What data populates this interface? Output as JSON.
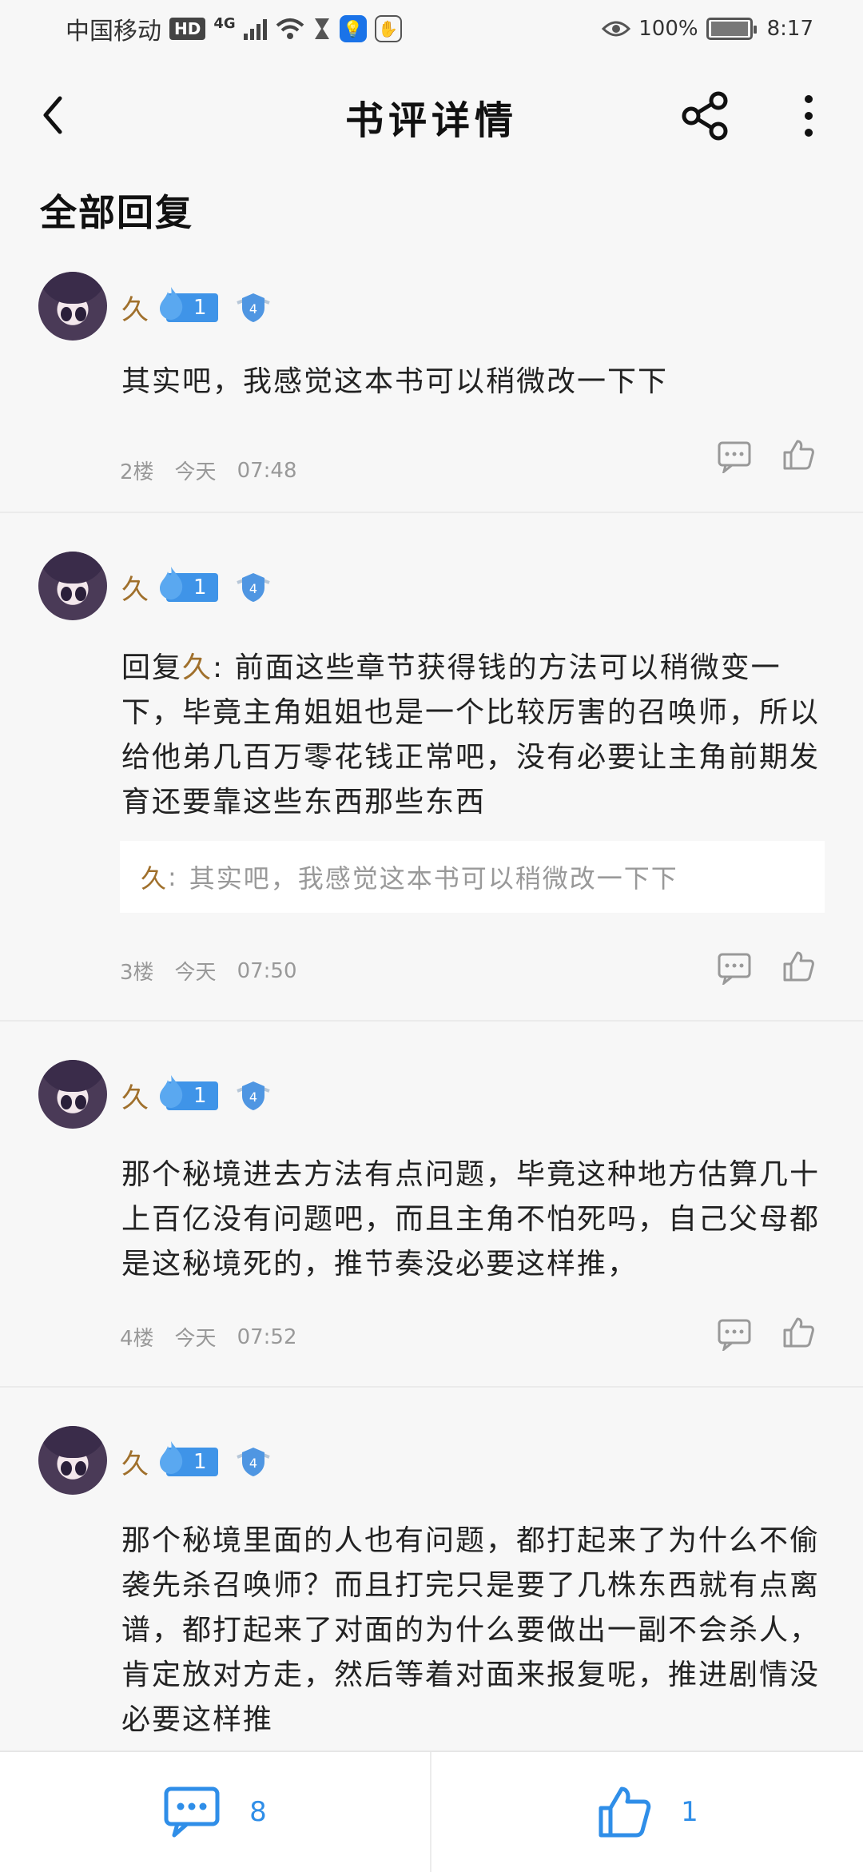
{
  "status_bar": {
    "carrier": "中国移动",
    "hd": "HD",
    "network": "4G",
    "battery": "100%",
    "time": "8:17"
  },
  "header": {
    "title": "书评详情"
  },
  "section": {
    "title": "全部回复"
  },
  "comments": [
    {
      "username": "久",
      "level": "1",
      "shield": "4",
      "text": "其实吧，我感觉这本书可以稍微改一下下",
      "floor": "2楼",
      "date": "今天",
      "time": "07:48"
    },
    {
      "username": "久",
      "level": "1",
      "shield": "4",
      "reply_prefix": "回复",
      "reply_to": "久",
      "reply_colon": ":",
      "text": "前面这些章节获得钱的方法可以稍微变一下，毕竟主角姐姐也是一个比较厉害的召唤师，所以给他弟几百万零花钱正常吧，没有必要让主角前期发育还要靠这些东西那些东西",
      "quote_name": "久",
      "quote_colon": ":",
      "quote_text": "其实吧，我感觉这本书可以稍微改一下下",
      "floor": "3楼",
      "date": "今天",
      "time": "07:50"
    },
    {
      "username": "久",
      "level": "1",
      "shield": "4",
      "text": "那个秘境进去方法有点问题，毕竟这种地方估算几十上百亿没有问题吧，而且主角不怕死吗，自己父母都是这秘境死的，推节奏没必要这样推，",
      "floor": "4楼",
      "date": "今天",
      "time": "07:52"
    },
    {
      "username": "久",
      "level": "1",
      "shield": "4",
      "text": "那个秘境里面的人也有问题，都打起来了为什么不偷袭先杀召唤师？而且打完只是要了几株东西就有点离谱，都打起来了对面的为什么要做出一副不会杀人，肯定放对方走，然后等着对面来报复呢，推进剧情没必要这样推"
    }
  ],
  "bottom_bar": {
    "reply_count": "8",
    "like_count": "1"
  },
  "colors": {
    "accent_blue": "#2f8ee8",
    "username_brown": "#a0702c",
    "meta_gray": "#999999"
  }
}
